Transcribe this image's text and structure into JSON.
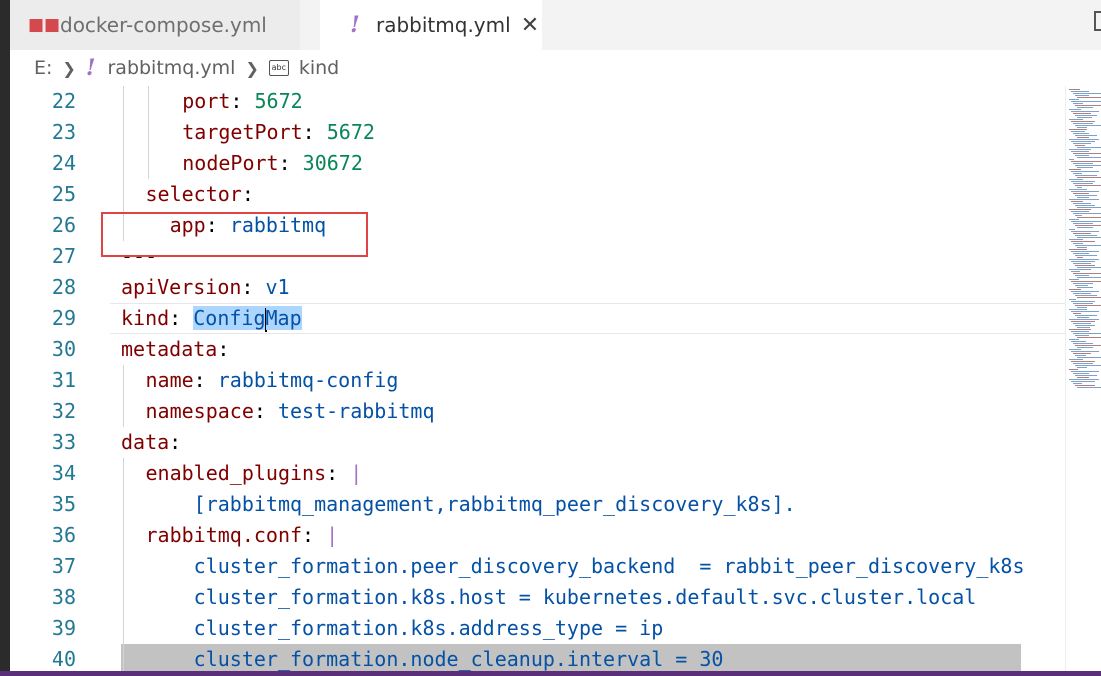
{
  "tabs": [
    {
      "label": "docker-compose.yml",
      "active": false,
      "icon": "docker-whale-icon"
    },
    {
      "label": "rabbitmq.yml",
      "active": true,
      "icon": "yaml-exclamation-icon"
    }
  ],
  "breadcrumb": {
    "drive": "E:",
    "file": "rabbitmq.yml",
    "symbol": "kind",
    "symbol_icon_text": "abc"
  },
  "editor": {
    "current_line": 29,
    "lines": [
      {
        "num": "22",
        "indent": 2,
        "tokens": [
          {
            "t": "port",
            "c": "k"
          },
          {
            "t": ": ",
            "c": "p"
          },
          {
            "t": "5672",
            "c": "n"
          }
        ]
      },
      {
        "num": "23",
        "indent": 2,
        "tokens": [
          {
            "t": "targetPort",
            "c": "k"
          },
          {
            "t": ": ",
            "c": "p"
          },
          {
            "t": "5672",
            "c": "n"
          }
        ]
      },
      {
        "num": "24",
        "indent": 2,
        "tokens": [
          {
            "t": "nodePort",
            "c": "k"
          },
          {
            "t": ": ",
            "c": "p"
          },
          {
            "t": "30672",
            "c": "n"
          }
        ]
      },
      {
        "num": "25",
        "indent": 1,
        "tokens": [
          {
            "t": "selector",
            "c": "k"
          },
          {
            "t": ":",
            "c": "p"
          }
        ]
      },
      {
        "num": "26",
        "indent": 1,
        "tokens": [
          {
            "t": "  app",
            "c": "k"
          },
          {
            "t": ": ",
            "c": "p"
          },
          {
            "t": "rabbitmq",
            "c": "s"
          }
        ]
      },
      {
        "num": "27",
        "indent": 0,
        "tokens": [
          {
            "t": "---",
            "c": "p"
          }
        ]
      },
      {
        "num": "28",
        "indent": 0,
        "tokens": [
          {
            "t": "apiVersion",
            "c": "k"
          },
          {
            "t": ": ",
            "c": "p"
          },
          {
            "t": "v1",
            "c": "s"
          }
        ]
      },
      {
        "num": "29",
        "indent": 0,
        "tokens": [
          {
            "t": "kind",
            "c": "k"
          },
          {
            "t": ": ",
            "c": "p"
          },
          {
            "t": "Config",
            "c": "s sel"
          },
          {
            "t": "",
            "c": "cursor"
          },
          {
            "t": "Map",
            "c": "s sel"
          }
        ]
      },
      {
        "num": "30",
        "indent": 0,
        "tokens": [
          {
            "t": "metadata",
            "c": "k"
          },
          {
            "t": ":",
            "c": "p"
          }
        ]
      },
      {
        "num": "31",
        "indent": 1,
        "tokens": [
          {
            "t": "name",
            "c": "k"
          },
          {
            "t": ": ",
            "c": "p"
          },
          {
            "t": "rabbitmq-config",
            "c": "s"
          }
        ]
      },
      {
        "num": "32",
        "indent": 1,
        "tokens": [
          {
            "t": "namespace",
            "c": "k"
          },
          {
            "t": ": ",
            "c": "p"
          },
          {
            "t": "test-rabbitmq",
            "c": "s"
          }
        ]
      },
      {
        "num": "33",
        "indent": 0,
        "tokens": [
          {
            "t": "data",
            "c": "k"
          },
          {
            "t": ":",
            "c": "p"
          }
        ]
      },
      {
        "num": "34",
        "indent": 1,
        "tokens": [
          {
            "t": "enabled_plugins",
            "c": "k"
          },
          {
            "t": ": ",
            "c": "p"
          },
          {
            "t": "|",
            "c": "bar"
          }
        ]
      },
      {
        "num": "35",
        "indent": 1,
        "tokens": [
          {
            "t": "    [rabbitmq_management,rabbitmq_peer_discovery_k8s].",
            "c": "s"
          }
        ]
      },
      {
        "num": "36",
        "indent": 1,
        "tokens": [
          {
            "t": "rabbitmq.conf",
            "c": "k"
          },
          {
            "t": ": ",
            "c": "p"
          },
          {
            "t": "|",
            "c": "bar"
          }
        ]
      },
      {
        "num": "37",
        "indent": 1,
        "tokens": [
          {
            "t": "    cluster_formation.peer_discovery_backend  = rabbit_peer_discovery_k8s",
            "c": "s"
          }
        ]
      },
      {
        "num": "38",
        "indent": 1,
        "tokens": [
          {
            "t": "    cluster_formation.k8s.host = kubernetes.default.svc.cluster.local",
            "c": "s"
          }
        ]
      },
      {
        "num": "39",
        "indent": 1,
        "tokens": [
          {
            "t": "    cluster_formation.k8s.address_type = ip",
            "c": "s"
          }
        ]
      },
      {
        "num": "40",
        "indent": 1,
        "tokens": [
          {
            "t": "    cluster_formation.node_cleanup.interval = 30",
            "c": "s"
          }
        ]
      }
    ]
  },
  "colors": {
    "key": "#800000",
    "string": "#0451a5",
    "number": "#098658",
    "line_number": "#237893",
    "highlight_box": "#e04343"
  }
}
